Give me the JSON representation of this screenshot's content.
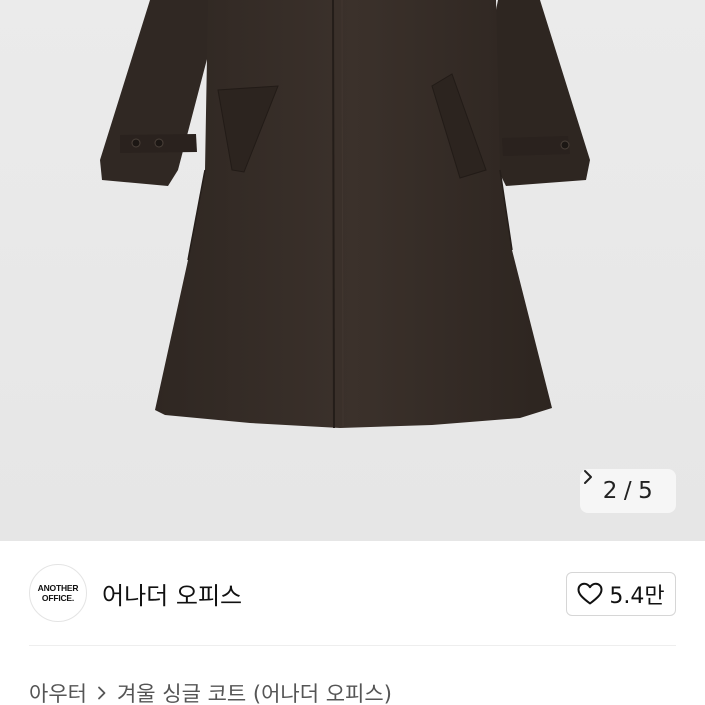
{
  "product_image": {
    "icon": "coat-photo",
    "background_color": "#e9e9e9",
    "coat_color": "#3a3029"
  },
  "image_counter": {
    "current": "2",
    "separator": "/",
    "total": "5",
    "icon": "chevron-right-icon"
  },
  "shop": {
    "logo_line1": "ANOTHER",
    "logo_line2": "OFFICE.",
    "name": "어나더 오피스"
  },
  "like": {
    "icon": "heart-outline-icon",
    "count": "5.4만"
  },
  "breadcrumb": {
    "category": "아우터",
    "separator_icon": "chevron-right-icon",
    "product": "겨울 싱글 코트 (어나더 오피스)"
  }
}
